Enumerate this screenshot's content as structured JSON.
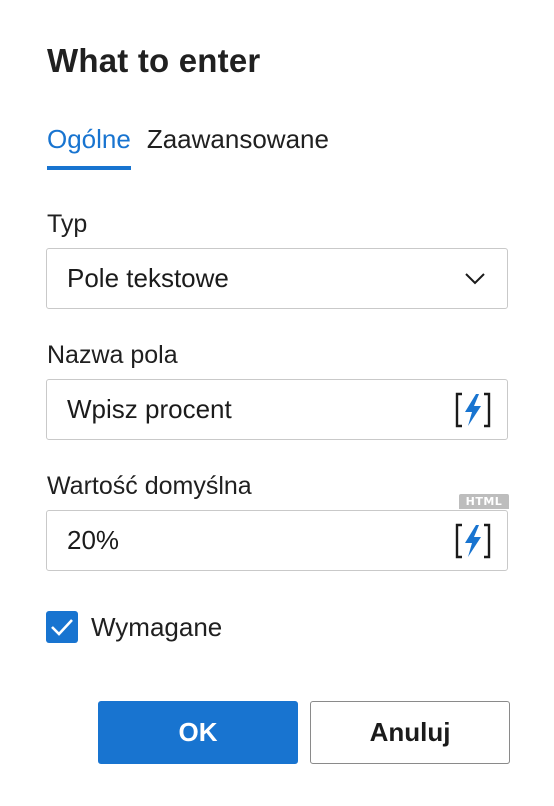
{
  "dialog": {
    "title": "What to enter"
  },
  "tabs": [
    {
      "label": "Ogólne",
      "active": true
    },
    {
      "label": "Zaawansowane",
      "active": false
    }
  ],
  "fields": {
    "type": {
      "label": "Typ",
      "value": "Pole tekstowe",
      "icon": "chevron-down-icon"
    },
    "field_name": {
      "label": "Nazwa pola",
      "value": "Wpisz procent",
      "icon": "insert-variable-icon"
    },
    "default_value": {
      "label": "Wartość domyślna",
      "value": "20%",
      "badge": "HTML",
      "icon": "insert-variable-icon"
    }
  },
  "required": {
    "label": "Wymagane",
    "checked": true
  },
  "buttons": {
    "ok": "OK",
    "cancel": "Anuluj"
  },
  "colors": {
    "accent": "#1874d0",
    "border": "#c9c9c9",
    "badge": "#bdbdbd"
  }
}
